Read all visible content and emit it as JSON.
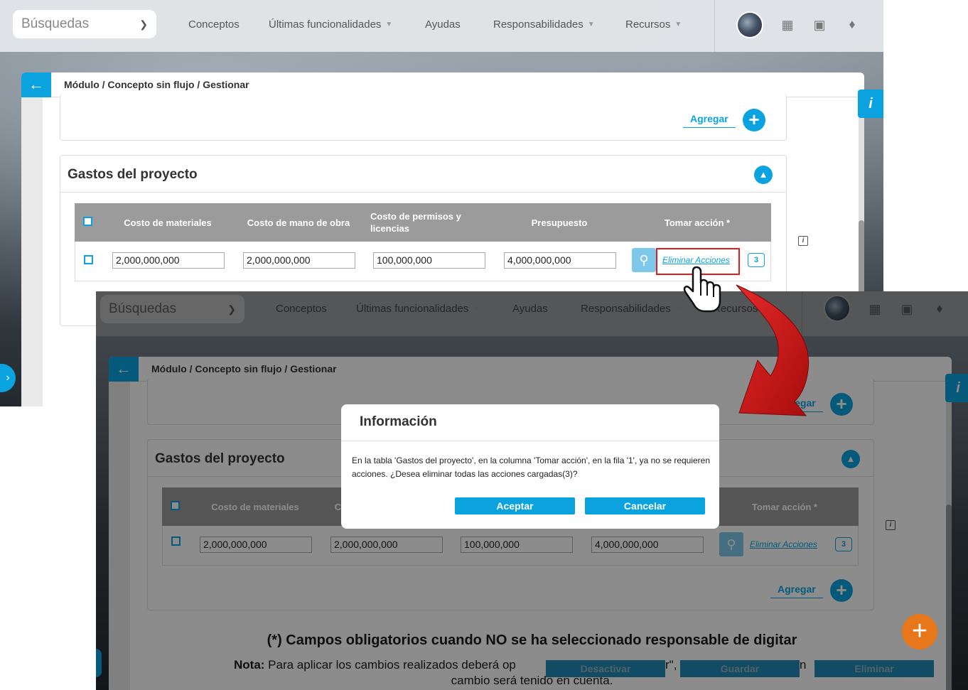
{
  "nav": {
    "search_placeholder": "Búsquedas",
    "items": [
      {
        "label": "Conceptos",
        "caret": false
      },
      {
        "label": "Últimas funcionalidades",
        "caret": true
      },
      {
        "label": "Ayudas",
        "caret": false
      },
      {
        "label": "Responsabilidades",
        "caret": true
      },
      {
        "label": "Recursos",
        "caret": true
      }
    ]
  },
  "breadcrumb": "Módulo / Concepto sin flujo / Gestionar",
  "add_label": "Agregar",
  "section": {
    "title": "Gastos del proyecto"
  },
  "table": {
    "headers": [
      "Costo de materiales",
      "Costo de mano de obra",
      "Costo de permisos y licencias",
      "Presupuesto",
      "Tomar acción *"
    ],
    "row": [
      "2,000,000,000",
      "2,000,000,000",
      "100,000,000",
      "4,000,000,000"
    ],
    "action_link": "Eliminar Acciones",
    "action_count": "3"
  },
  "dialog": {
    "title": "Información",
    "message": "En la tabla 'Gastos del proyecto', en la columna 'Tomar acción', en la fila '1', ya no se requieren acciones. ¿Desea eliminar todas las acciones cargadas(3)?",
    "accept": "Aceptar",
    "cancel": "Cancelar"
  },
  "footer": {
    "required_note": "(*) Campos obligatorios cuando NO se ha seleccionado responsable de digitar",
    "note_label": "Nota:",
    "note_text_a": " Para aplicar los cambios realizados deberá op",
    "note_text_b": "r\",",
    "note_text_c": "n",
    "note_text_d": "cambio será tenido en cuenta.",
    "buttons": [
      "Desactivar",
      "Guardar",
      "Eliminar"
    ]
  },
  "colors": {
    "accent": "#0aa3e0",
    "highlight": "#e21b1b",
    "fab": "#e8761a"
  },
  "icons": [
    "chevron-down-icon",
    "calendar-icon",
    "book-icon",
    "bell-icon",
    "back-arrow-icon",
    "plus-icon",
    "chevron-up-icon",
    "search-icon",
    "info-icon",
    "hand-pointer-icon",
    "curved-arrow-icon"
  ]
}
